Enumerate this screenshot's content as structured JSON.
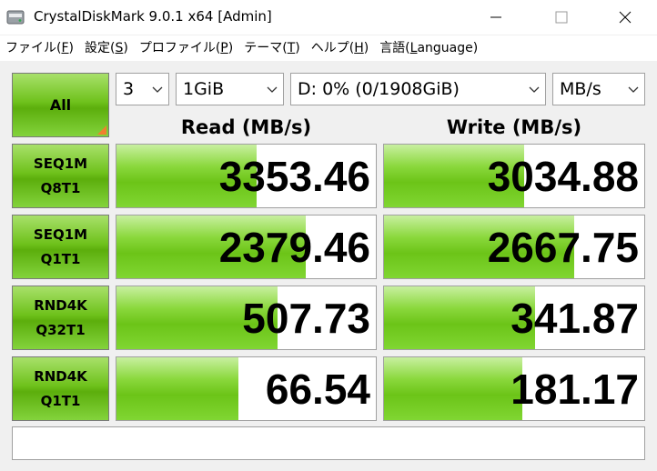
{
  "window": {
    "title": "CrystalDiskMark 9.0.1 x64 [Admin]",
    "minimize_glyph": "—",
    "close_glyph": "✕"
  },
  "menu": [
    {
      "pre": "ファイル(",
      "key": "F",
      "post": ")"
    },
    {
      "pre": "設定(",
      "key": "S",
      "post": ")"
    },
    {
      "pre": "プロファイル(",
      "key": "P",
      "post": ")"
    },
    {
      "pre": "テーマ(",
      "key": "T",
      "post": ")"
    },
    {
      "pre": "ヘルプ(",
      "key": "H",
      "post": ")"
    },
    {
      "pre": "言語(",
      "key": "L",
      "post": "anguage)"
    }
  ],
  "controls": {
    "all_label": "All",
    "count": "3",
    "size": "1GiB",
    "drive": "D: 0% (0/1908GiB)",
    "unit": "MB/s"
  },
  "headers": {
    "read": "Read (MB/s)",
    "write": "Write (MB/s)"
  },
  "rows": [
    {
      "line1": "SEQ1M",
      "line2": "Q8T1",
      "read": "3353.46",
      "write": "3034.88",
      "read_fill": 0.54,
      "write_fill": 0.54
    },
    {
      "line1": "SEQ1M",
      "line2": "Q1T1",
      "read": "2379.46",
      "write": "2667.75",
      "read_fill": 0.73,
      "write_fill": 0.73
    },
    {
      "line1": "RND4K",
      "line2": "Q32T1",
      "read": "507.73",
      "write": "341.87",
      "read_fill": 0.62,
      "write_fill": 0.58
    },
    {
      "line1": "RND4K",
      "line2": "Q1T1",
      "read": "66.54",
      "write": "181.17",
      "read_fill": 0.47,
      "write_fill": 0.53
    }
  ],
  "comment": "",
  "colors": {
    "accent_green": "#6cc418",
    "corner_orange": "#f08030"
  },
  "icons": {
    "app": "disk-icon",
    "dropdown": "chevron-down-icon"
  }
}
